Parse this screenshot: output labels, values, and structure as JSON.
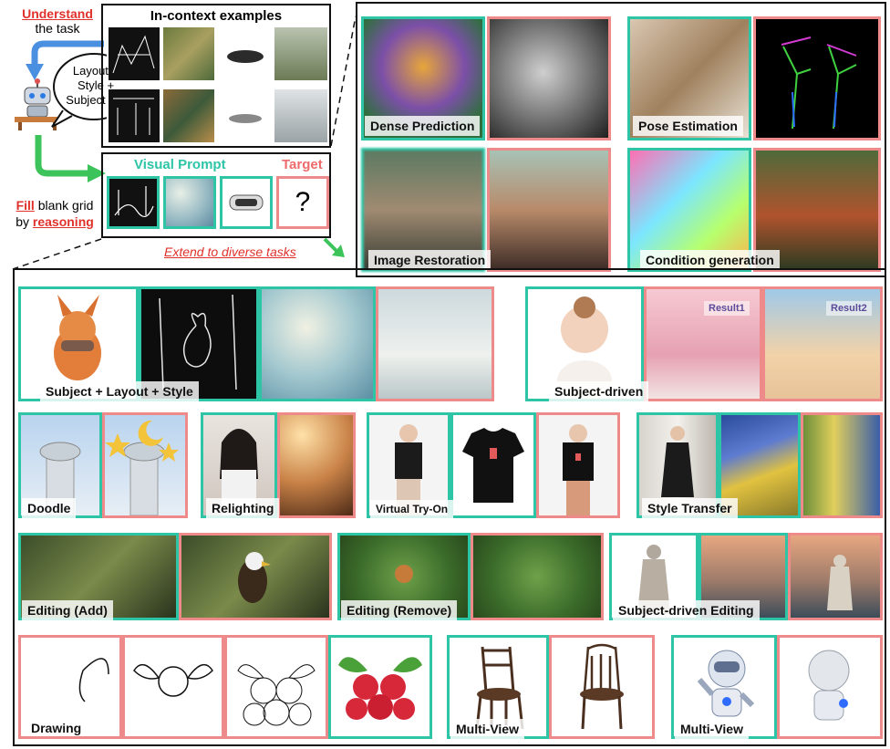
{
  "left_panel": {
    "understand": "Understand",
    "the_task": "the task",
    "bubble_lines": [
      "Layout +",
      "Style +",
      "Subject = ?"
    ],
    "fill": "Fill",
    "fill_rest": " blank grid",
    "by": "by ",
    "reasoning": "reasoning",
    "in_context_title": "In-context examples",
    "visual_prompt": "Visual Prompt",
    "target": "Target",
    "question_mark": "?",
    "extend": "Extend to diverse tasks"
  },
  "tasks": {
    "dense_prediction": "Dense Prediction",
    "pose_estimation": "Pose Estimation",
    "image_restoration": "Image Restoration",
    "condition_generation": "Condition generation",
    "subject_layout_style": "Subject + Layout + Style",
    "subject_driven": "Subject-driven",
    "result1": "Result1",
    "result2": "Result2",
    "doodle": "Doodle",
    "relighting": "Relighting",
    "virtual_try_on": "Virtual Try-On",
    "style_transfer": "Style Transfer",
    "editing_add": "Editing (Add)",
    "editing_remove": "Editing (Remove)",
    "subject_driven_editing": "Subject-driven Editing",
    "drawing": "Drawing",
    "multi_view_1": "Multi-View",
    "multi_view_2": "Multi-View"
  },
  "colors": {
    "prompt_border": "#2ec4a6",
    "target_border": "#ef8a8a",
    "emphasis": "#e0312a"
  }
}
